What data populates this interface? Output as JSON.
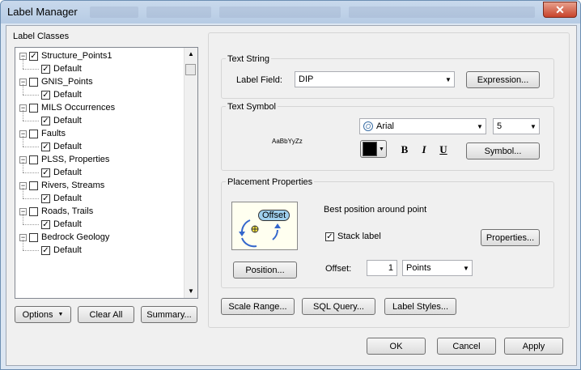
{
  "window": {
    "title": "Label Manager",
    "close_glyph": "✕"
  },
  "label_classes": {
    "title": "Label Classes",
    "items": [
      {
        "name": "Structure_Points1",
        "checked": true,
        "child": "Default"
      },
      {
        "name": "GNIS_Points",
        "checked": false,
        "child": "Default"
      },
      {
        "name": "MILS Occurrences",
        "checked": false,
        "child": "Default"
      },
      {
        "name": "Faults",
        "checked": false,
        "child": "Default"
      },
      {
        "name": "PLSS, Properties",
        "checked": false,
        "child": "Default"
      },
      {
        "name": "Rivers, Streams",
        "checked": false,
        "child": "Default"
      },
      {
        "name": "Roads, Trails",
        "checked": false,
        "child": "Default"
      },
      {
        "name": "Bedrock Geology",
        "checked": false,
        "child": "Default"
      }
    ],
    "options_label": "Options",
    "clear_all_label": "Clear All",
    "summary_label": "Summary..."
  },
  "text_string": {
    "title": "Text String",
    "label_field_label": "Label Field:",
    "label_field_value": "DIP",
    "expression_label": "Expression..."
  },
  "text_symbol": {
    "title": "Text Symbol",
    "preview_text": "AaBbYyZz",
    "font_value": "Arial",
    "size_value": "5",
    "bold": "B",
    "italic": "I",
    "underline": "U",
    "symbol_label": "Symbol..."
  },
  "placement": {
    "title": "Placement Properties",
    "offset_badge": "Offset",
    "description": "Best position around point",
    "stack_label": "Stack label",
    "stack_checked": true,
    "properties_label": "Properties...",
    "position_label": "Position...",
    "offset_label": "Offset:",
    "offset_value": "1",
    "offset_unit": "Points"
  },
  "bottom_buttons": {
    "scale_range": "Scale Range...",
    "sql_query": "SQL Query...",
    "label_styles": "Label Styles..."
  },
  "dialog_buttons": {
    "ok": "OK",
    "cancel": "Cancel",
    "apply": "Apply"
  },
  "icons": {
    "check": "✓",
    "minus": "−",
    "dropdown": "▼",
    "scroll_up": "▲",
    "scroll_down": "▼",
    "font_type": "O"
  },
  "colors": {
    "font_color": "#000000",
    "offset_badge": "#9fd0ee"
  }
}
